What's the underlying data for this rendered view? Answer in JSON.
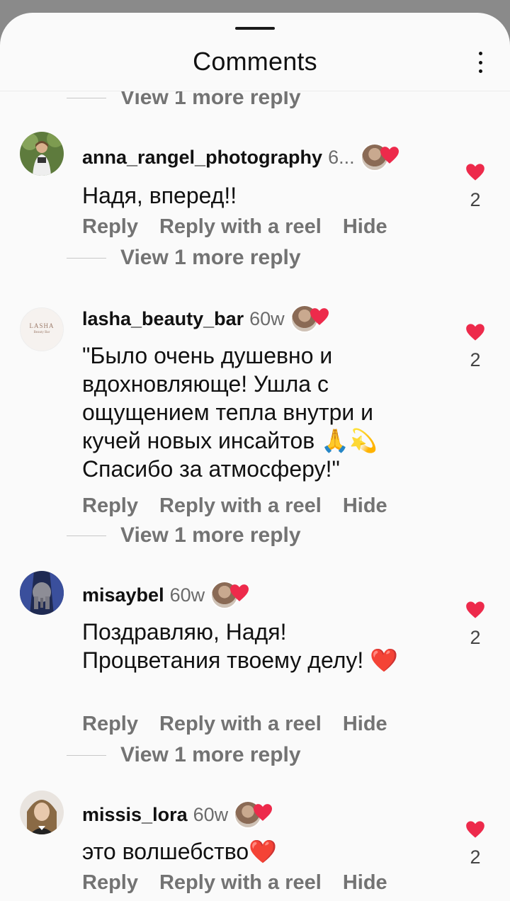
{
  "header": {
    "title": "Comments"
  },
  "view_more_label": "View 1 more reply",
  "actions": {
    "reply": "Reply",
    "reply_reel": "Reply with a reel",
    "hide": "Hide"
  },
  "comments": [
    {
      "username": "anna_rangel_photography",
      "time": "6...",
      "text": "Надя, вперед!!",
      "likes": "2"
    },
    {
      "username": "lasha_beauty_bar",
      "time": "60w",
      "text": "\"Было очень душевно и вдохновляюще! Ушла с ощущением тепла внутри и кучей новых инсайтов 🙏💫 Спасибо за атмосферу!\"",
      "likes": "2",
      "avatar_text": "LASHA",
      "avatar_subtext": "Beauty Bar"
    },
    {
      "username": "misaybel",
      "time": "60w",
      "text": "Поздравляю, Надя! Процветания твоему делу! ❤️",
      "likes": "2"
    },
    {
      "username": "missis_lora",
      "time": "60w",
      "text": "это волшебство❤️",
      "likes": "2"
    }
  ],
  "colors": {
    "heart": "#ed2a4b",
    "secondary_text": "#737373"
  },
  "icons": [
    "more-options-icon",
    "heart-icon",
    "liked-by-heart-icon"
  ]
}
